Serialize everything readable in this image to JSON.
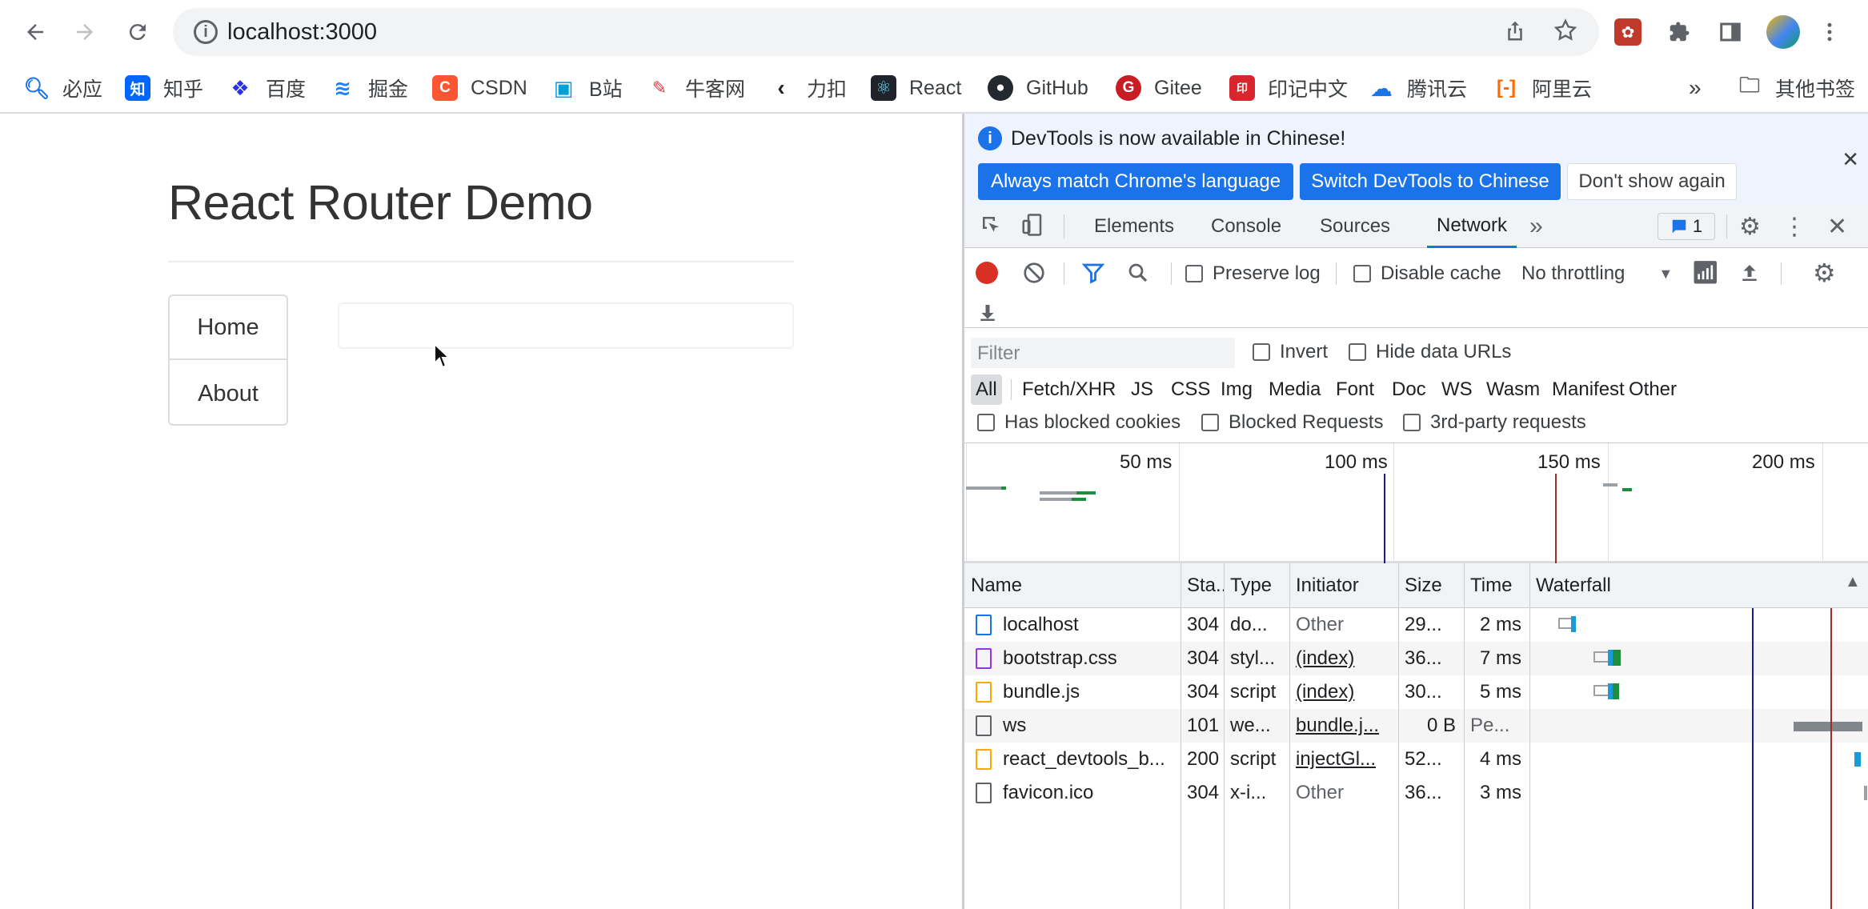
{
  "browser": {
    "url": "localhost:3000",
    "bookmarks": [
      {
        "label": "必应",
        "icon": "bing-search-icon",
        "color": "#1a73e8"
      },
      {
        "label": "知乎",
        "icon": "zhihu-icon",
        "color": "#0066ff"
      },
      {
        "label": "百度",
        "icon": "baidu-paw-icon",
        "color": "#2932e1"
      },
      {
        "label": "掘金",
        "icon": "juejin-icon",
        "color": "#1e80ff"
      },
      {
        "label": "CSDN",
        "icon": "csdn-icon",
        "color": "#fc5531"
      },
      {
        "label": "B站",
        "icon": "bilibili-icon",
        "color": "#00a1d6"
      },
      {
        "label": "牛客网",
        "icon": "nowcoder-icon",
        "color": "#e4393c"
      },
      {
        "label": "力扣",
        "icon": "leetcode-icon",
        "color": "#ffa116"
      },
      {
        "label": "React",
        "icon": "react-icon",
        "color": "#61dafb"
      },
      {
        "label": "GitHub",
        "icon": "github-icon",
        "color": "#24292f"
      },
      {
        "label": "Gitee",
        "icon": "gitee-icon",
        "color": "#c71d23"
      },
      {
        "label": "印记中文",
        "icon": "docschina-icon",
        "color": "#d7262d"
      },
      {
        "label": "腾讯云",
        "icon": "tencent-cloud-icon",
        "color": "#1a73e8"
      },
      {
        "label": "阿里云",
        "icon": "aliyun-icon",
        "color": "#ff6a00"
      }
    ],
    "more_chevron": "»",
    "other_bookmarks": "其他书签"
  },
  "page": {
    "title": "React Router Demo",
    "nav": [
      "Home",
      "About"
    ]
  },
  "devtools": {
    "infobar": {
      "message": "DevTools is now available in Chinese!",
      "btn_match": "Always match Chrome's language",
      "btn_switch": "Switch DevTools to Chinese",
      "btn_dismiss": "Don't show again"
    },
    "tabs": [
      "Elements",
      "Console",
      "Sources",
      "Network"
    ],
    "active_tab": "Network",
    "issues_count": "1",
    "network": {
      "preserve_log": "Preserve log",
      "disable_cache": "Disable cache",
      "throttling": "No throttling",
      "filter_placeholder": "Filter",
      "invert": "Invert",
      "hide_data_urls": "Hide data URLs",
      "types": [
        "All",
        "Fetch/XHR",
        "JS",
        "CSS",
        "Img",
        "Media",
        "Font",
        "Doc",
        "WS",
        "Wasm",
        "Manifest",
        "Other"
      ],
      "has_blocked_cookies": "Has blocked cookies",
      "blocked_requests": "Blocked Requests",
      "third_party": "3rd-party requests",
      "timeline_labels": [
        "50 ms",
        "100 ms",
        "150 ms",
        "200 ms"
      ],
      "columns": [
        "Name",
        "Sta..",
        "Type",
        "Initiator",
        "Size",
        "Time",
        "Waterfall"
      ],
      "rows": [
        {
          "name": "localhost",
          "status": "304",
          "type": "do...",
          "initiator": "Other",
          "size": "29...",
          "time": "2 ms",
          "icon": "document-icon"
        },
        {
          "name": "bootstrap.css",
          "status": "304",
          "type": "styl...",
          "initiator": "(index)",
          "size": "36...",
          "time": "7 ms",
          "icon": "stylesheet-icon"
        },
        {
          "name": "bundle.js",
          "status": "304",
          "type": "script",
          "initiator": "(index)",
          "size": "30...",
          "time": "5 ms",
          "icon": "script-icon"
        },
        {
          "name": "ws",
          "status": "101",
          "type": "we...",
          "initiator": "bundle.j...",
          "size": "0 B",
          "time": "Pe...",
          "icon": "websocket-icon"
        },
        {
          "name": "react_devtools_b...",
          "status": "200",
          "type": "script",
          "initiator": "injectGl...",
          "size": "52...",
          "time": "4 ms",
          "icon": "script-icon"
        },
        {
          "name": "favicon.ico",
          "status": "304",
          "type": "x-i...",
          "initiator": "Other",
          "size": "36...",
          "time": "3 ms",
          "icon": "file-icon"
        }
      ]
    }
  },
  "colors": {
    "accent": "#1a73e8",
    "record": "#d93025",
    "dom_content_loaded_line": "#1a1aa6",
    "load_line": "#a42b23"
  }
}
